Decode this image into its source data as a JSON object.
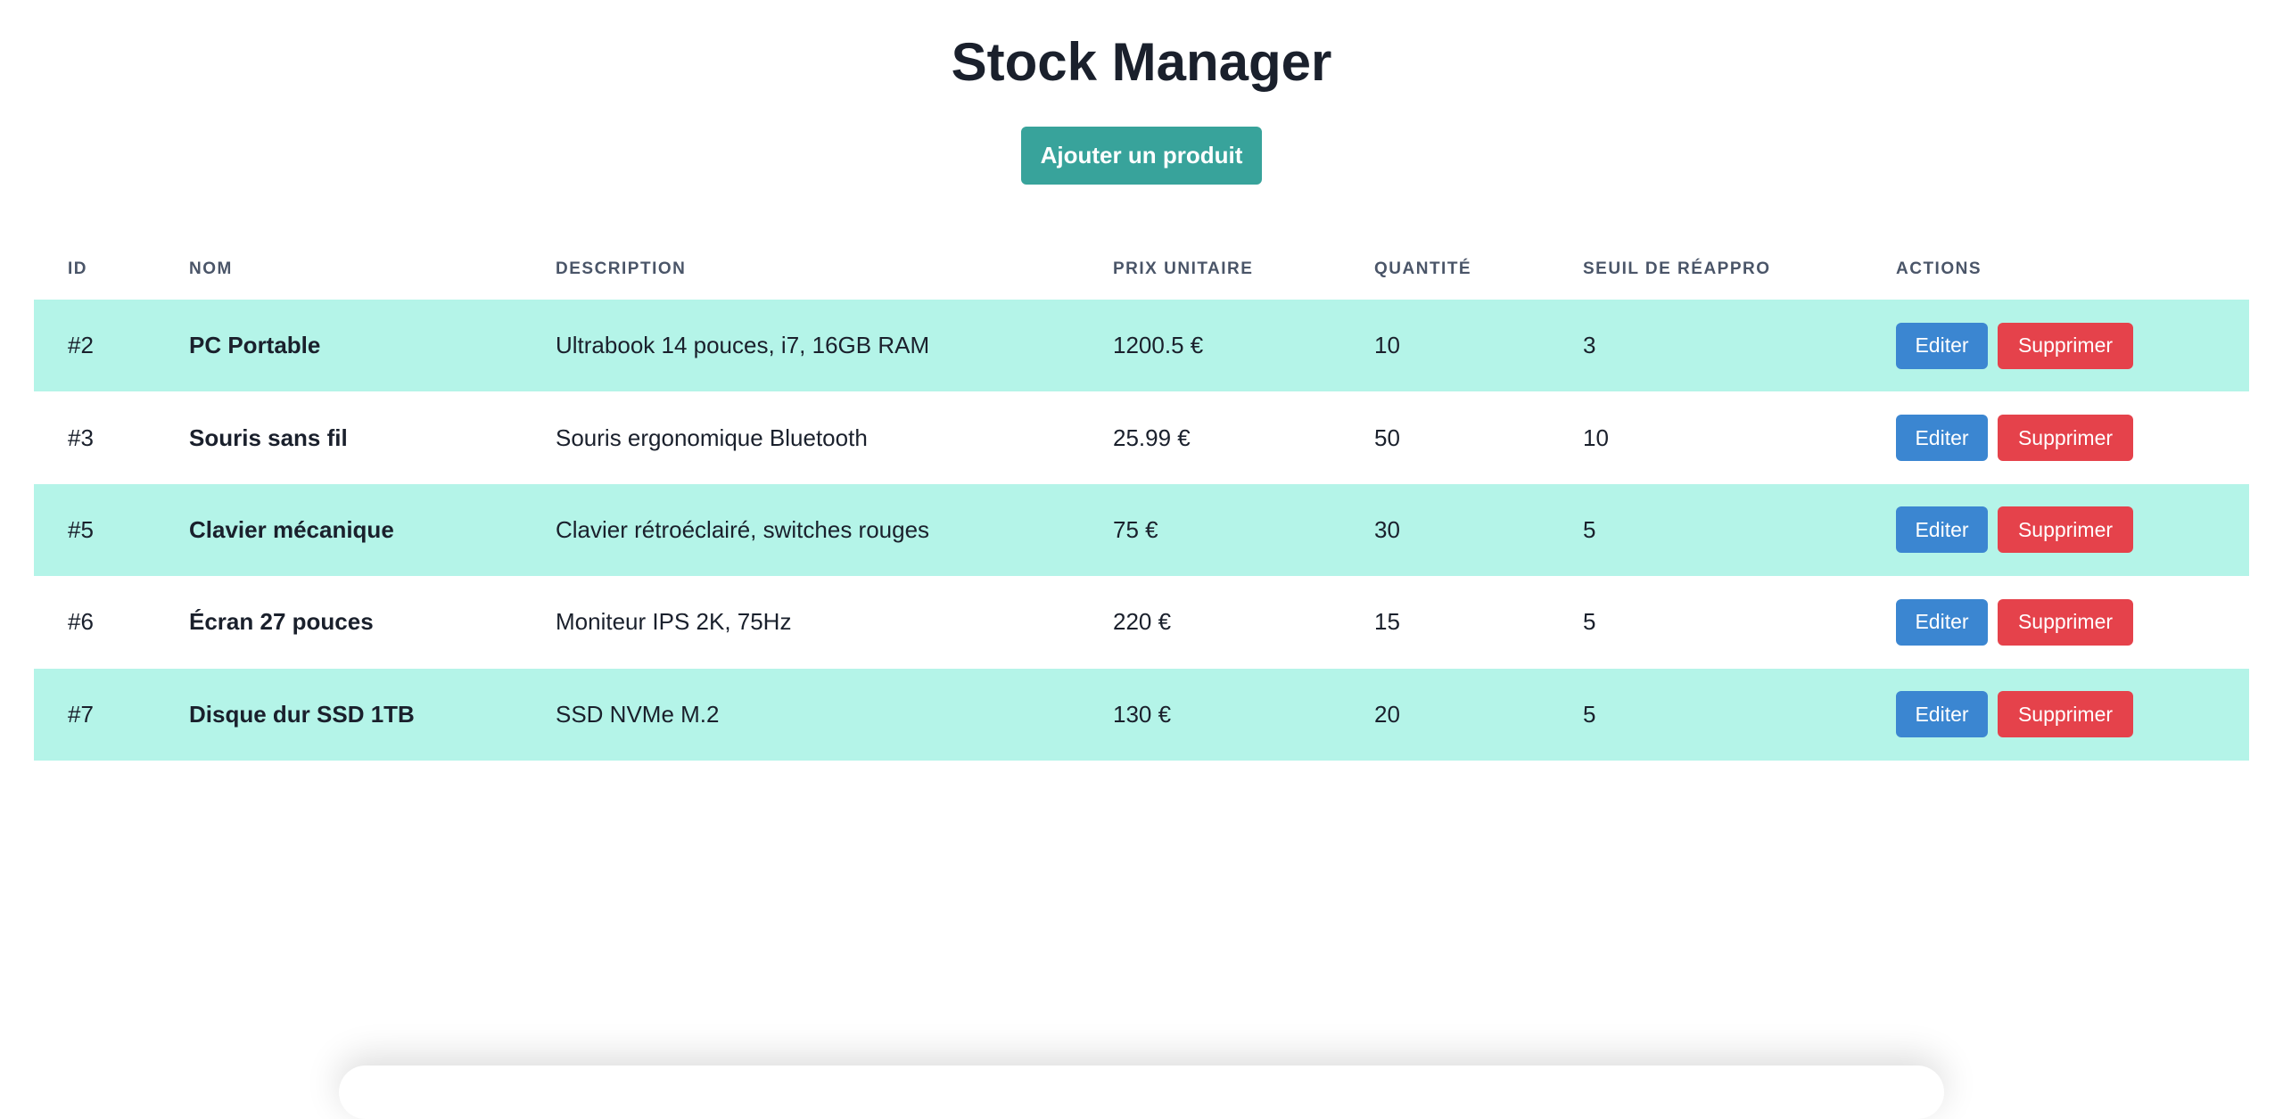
{
  "header": {
    "title": "Stock Manager",
    "add_button_label": "Ajouter un produit"
  },
  "table": {
    "columns": [
      "ID",
      "NOM",
      "DESCRIPTION",
      "PRIX UNITAIRE",
      "QUANTITÉ",
      "SEUIL DE RÉAPPRO",
      "ACTIONS"
    ],
    "rows": [
      {
        "id": "#2",
        "name": "PC Portable",
        "description": "Ultrabook 14 pouces, i7, 16GB RAM",
        "price": "1200.5 €",
        "quantity": "10",
        "threshold": "3",
        "edit_label": "Editer",
        "delete_label": "Supprimer"
      },
      {
        "id": "#3",
        "name": "Souris sans fil",
        "description": "Souris ergonomique Bluetooth",
        "price": "25.99 €",
        "quantity": "50",
        "threshold": "10",
        "edit_label": "Editer",
        "delete_label": "Supprimer"
      },
      {
        "id": "#5",
        "name": "Clavier mécanique",
        "description": "Clavier rétroéclairé, switches rouges",
        "price": "75 €",
        "quantity": "30",
        "threshold": "5",
        "edit_label": "Editer",
        "delete_label": "Supprimer"
      },
      {
        "id": "#6",
        "name": "Écran 27 pouces",
        "description": "Moniteur IPS 2K, 75Hz",
        "price": "220 €",
        "quantity": "15",
        "threshold": "5",
        "edit_label": "Editer",
        "delete_label": "Supprimer"
      },
      {
        "id": "#7",
        "name": "Disque dur SSD 1TB",
        "description": "SSD NVMe M.2",
        "price": "130 €",
        "quantity": "20",
        "threshold": "5",
        "edit_label": "Editer",
        "delete_label": "Supprimer"
      }
    ]
  },
  "colors": {
    "primary": "#38a39b",
    "row_highlight": "#b4f4e8",
    "edit": "#3b86d1",
    "delete": "#e5424b",
    "text": "#1a202c",
    "header_text": "#4a5568"
  }
}
